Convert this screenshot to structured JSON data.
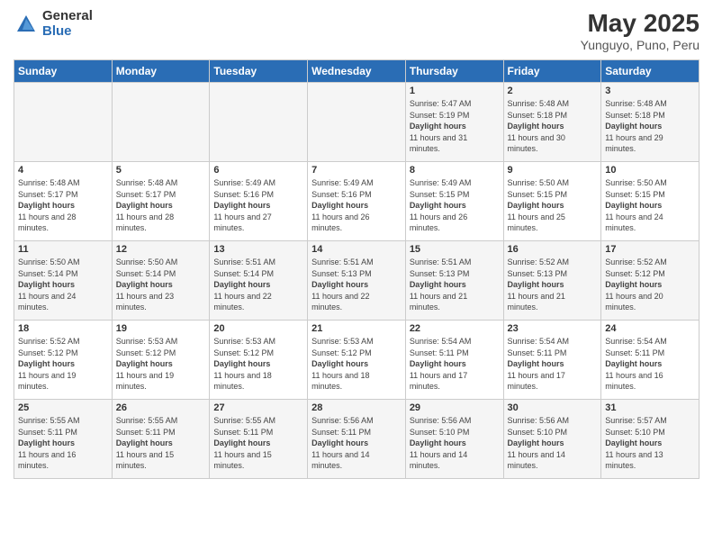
{
  "logo": {
    "general": "General",
    "blue": "Blue"
  },
  "title": "May 2025",
  "subtitle": "Yunguyo, Puno, Peru",
  "weekdays": [
    "Sunday",
    "Monday",
    "Tuesday",
    "Wednesday",
    "Thursday",
    "Friday",
    "Saturday"
  ],
  "weeks": [
    [
      {
        "day": "",
        "sunrise": "",
        "sunset": "",
        "daylight": ""
      },
      {
        "day": "",
        "sunrise": "",
        "sunset": "",
        "daylight": ""
      },
      {
        "day": "",
        "sunrise": "",
        "sunset": "",
        "daylight": ""
      },
      {
        "day": "",
        "sunrise": "",
        "sunset": "",
        "daylight": ""
      },
      {
        "day": "1",
        "sunrise": "Sunrise: 5:47 AM",
        "sunset": "Sunset: 5:19 PM",
        "daylight": "Daylight: 11 hours and 31 minutes."
      },
      {
        "day": "2",
        "sunrise": "Sunrise: 5:48 AM",
        "sunset": "Sunset: 5:18 PM",
        "daylight": "Daylight: 11 hours and 30 minutes."
      },
      {
        "day": "3",
        "sunrise": "Sunrise: 5:48 AM",
        "sunset": "Sunset: 5:18 PM",
        "daylight": "Daylight: 11 hours and 29 minutes."
      }
    ],
    [
      {
        "day": "4",
        "sunrise": "Sunrise: 5:48 AM",
        "sunset": "Sunset: 5:17 PM",
        "daylight": "Daylight: 11 hours and 28 minutes."
      },
      {
        "day": "5",
        "sunrise": "Sunrise: 5:48 AM",
        "sunset": "Sunset: 5:17 PM",
        "daylight": "Daylight: 11 hours and 28 minutes."
      },
      {
        "day": "6",
        "sunrise": "Sunrise: 5:49 AM",
        "sunset": "Sunset: 5:16 PM",
        "daylight": "Daylight: 11 hours and 27 minutes."
      },
      {
        "day": "7",
        "sunrise": "Sunrise: 5:49 AM",
        "sunset": "Sunset: 5:16 PM",
        "daylight": "Daylight: 11 hours and 26 minutes."
      },
      {
        "day": "8",
        "sunrise": "Sunrise: 5:49 AM",
        "sunset": "Sunset: 5:15 PM",
        "daylight": "Daylight: 11 hours and 26 minutes."
      },
      {
        "day": "9",
        "sunrise": "Sunrise: 5:50 AM",
        "sunset": "Sunset: 5:15 PM",
        "daylight": "Daylight: 11 hours and 25 minutes."
      },
      {
        "day": "10",
        "sunrise": "Sunrise: 5:50 AM",
        "sunset": "Sunset: 5:15 PM",
        "daylight": "Daylight: 11 hours and 24 minutes."
      }
    ],
    [
      {
        "day": "11",
        "sunrise": "Sunrise: 5:50 AM",
        "sunset": "Sunset: 5:14 PM",
        "daylight": "Daylight: 11 hours and 24 minutes."
      },
      {
        "day": "12",
        "sunrise": "Sunrise: 5:50 AM",
        "sunset": "Sunset: 5:14 PM",
        "daylight": "Daylight: 11 hours and 23 minutes."
      },
      {
        "day": "13",
        "sunrise": "Sunrise: 5:51 AM",
        "sunset": "Sunset: 5:14 PM",
        "daylight": "Daylight: 11 hours and 22 minutes."
      },
      {
        "day": "14",
        "sunrise": "Sunrise: 5:51 AM",
        "sunset": "Sunset: 5:13 PM",
        "daylight": "Daylight: 11 hours and 22 minutes."
      },
      {
        "day": "15",
        "sunrise": "Sunrise: 5:51 AM",
        "sunset": "Sunset: 5:13 PM",
        "daylight": "Daylight: 11 hours and 21 minutes."
      },
      {
        "day": "16",
        "sunrise": "Sunrise: 5:52 AM",
        "sunset": "Sunset: 5:13 PM",
        "daylight": "Daylight: 11 hours and 21 minutes."
      },
      {
        "day": "17",
        "sunrise": "Sunrise: 5:52 AM",
        "sunset": "Sunset: 5:12 PM",
        "daylight": "Daylight: 11 hours and 20 minutes."
      }
    ],
    [
      {
        "day": "18",
        "sunrise": "Sunrise: 5:52 AM",
        "sunset": "Sunset: 5:12 PM",
        "daylight": "Daylight: 11 hours and 19 minutes."
      },
      {
        "day": "19",
        "sunrise": "Sunrise: 5:53 AM",
        "sunset": "Sunset: 5:12 PM",
        "daylight": "Daylight: 11 hours and 19 minutes."
      },
      {
        "day": "20",
        "sunrise": "Sunrise: 5:53 AM",
        "sunset": "Sunset: 5:12 PM",
        "daylight": "Daylight: 11 hours and 18 minutes."
      },
      {
        "day": "21",
        "sunrise": "Sunrise: 5:53 AM",
        "sunset": "Sunset: 5:12 PM",
        "daylight": "Daylight: 11 hours and 18 minutes."
      },
      {
        "day": "22",
        "sunrise": "Sunrise: 5:54 AM",
        "sunset": "Sunset: 5:11 PM",
        "daylight": "Daylight: 11 hours and 17 minutes."
      },
      {
        "day": "23",
        "sunrise": "Sunrise: 5:54 AM",
        "sunset": "Sunset: 5:11 PM",
        "daylight": "Daylight: 11 hours and 17 minutes."
      },
      {
        "day": "24",
        "sunrise": "Sunrise: 5:54 AM",
        "sunset": "Sunset: 5:11 PM",
        "daylight": "Daylight: 11 hours and 16 minutes."
      }
    ],
    [
      {
        "day": "25",
        "sunrise": "Sunrise: 5:55 AM",
        "sunset": "Sunset: 5:11 PM",
        "daylight": "Daylight: 11 hours and 16 minutes."
      },
      {
        "day": "26",
        "sunrise": "Sunrise: 5:55 AM",
        "sunset": "Sunset: 5:11 PM",
        "daylight": "Daylight: 11 hours and 15 minutes."
      },
      {
        "day": "27",
        "sunrise": "Sunrise: 5:55 AM",
        "sunset": "Sunset: 5:11 PM",
        "daylight": "Daylight: 11 hours and 15 minutes."
      },
      {
        "day": "28",
        "sunrise": "Sunrise: 5:56 AM",
        "sunset": "Sunset: 5:11 PM",
        "daylight": "Daylight: 11 hours and 14 minutes."
      },
      {
        "day": "29",
        "sunrise": "Sunrise: 5:56 AM",
        "sunset": "Sunset: 5:10 PM",
        "daylight": "Daylight: 11 hours and 14 minutes."
      },
      {
        "day": "30",
        "sunrise": "Sunrise: 5:56 AM",
        "sunset": "Sunset: 5:10 PM",
        "daylight": "Daylight: 11 hours and 14 minutes."
      },
      {
        "day": "31",
        "sunrise": "Sunrise: 5:57 AM",
        "sunset": "Sunset: 5:10 PM",
        "daylight": "Daylight: 11 hours and 13 minutes."
      }
    ]
  ]
}
